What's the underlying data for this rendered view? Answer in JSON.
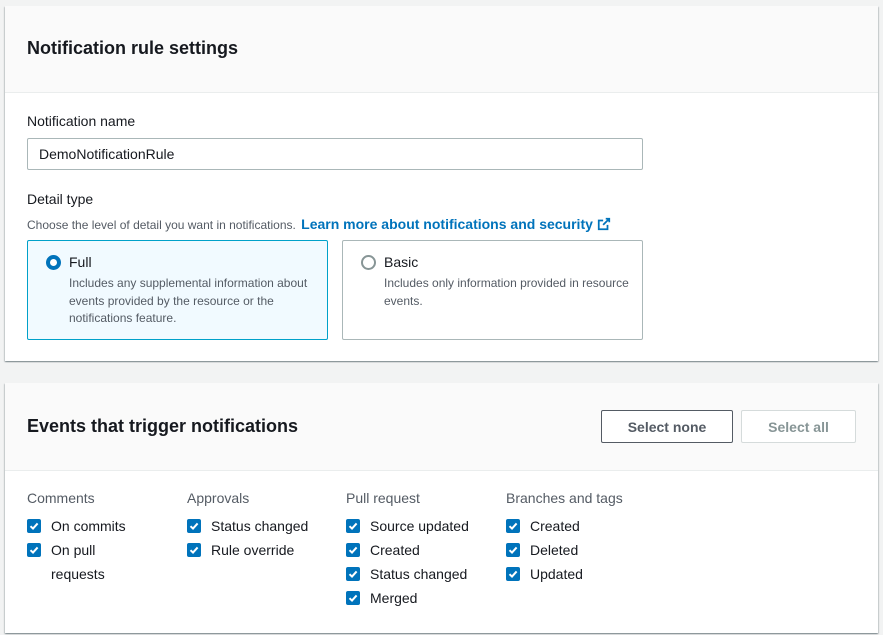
{
  "settings": {
    "title": "Notification rule settings",
    "name_label": "Notification name",
    "name_value": "DemoNotificationRule",
    "detail_label": "Detail type",
    "detail_description": "Choose the level of detail you want in notifications.",
    "learn_more_link": "Learn more about notifications and security",
    "options": [
      {
        "label": "Full",
        "description": "Includes any supplemental information about events provided by the resource or the notifications feature.",
        "selected": true
      },
      {
        "label": "Basic",
        "description": "Includes only information provided in resource events.",
        "selected": false
      }
    ]
  },
  "events": {
    "title": "Events that trigger notifications",
    "select_none_label": "Select none",
    "select_all_label": "Select all",
    "groups": [
      {
        "title": "Comments",
        "items": [
          "On commits",
          "On pull requests"
        ]
      },
      {
        "title": "Approvals",
        "items": [
          "Status changed",
          "Rule override"
        ]
      },
      {
        "title": "Pull request",
        "items": [
          "Source updated",
          "Created",
          "Status changed",
          "Merged"
        ]
      },
      {
        "title": "Branches and tags",
        "items": [
          "Created",
          "Deleted",
          "Updated"
        ]
      }
    ]
  },
  "colors": {
    "accent": "#0073bb",
    "selected_tile_bg": "#f1faff",
    "selected_tile_border": "#00a1c9"
  },
  "icons": {
    "external_link": "external-link-icon",
    "checkbox": "checkmark-icon"
  }
}
